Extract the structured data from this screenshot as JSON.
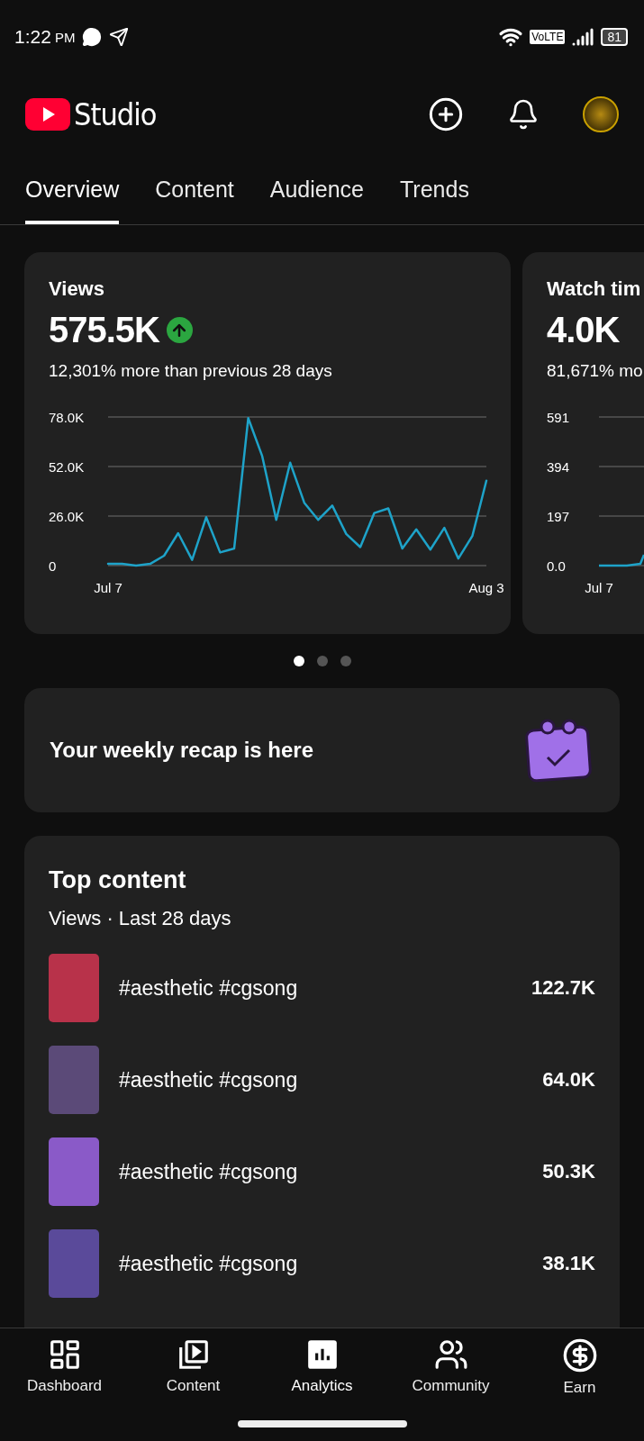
{
  "status_bar": {
    "time": "1:22",
    "period": "PM",
    "network": "VoLTE",
    "battery": "81"
  },
  "header": {
    "app_name": "Studio"
  },
  "tabs": [
    {
      "label": "Overview",
      "selected": true
    },
    {
      "label": "Content",
      "selected": false
    },
    {
      "label": "Audience",
      "selected": false
    },
    {
      "label": "Trends",
      "selected": false
    }
  ],
  "metric_cards": [
    {
      "title": "Views",
      "value": "575.5K",
      "comparison": "12,301% more than previous 28 days",
      "chart_data": {
        "type": "line",
        "categories": [
          "Jul 7",
          null,
          null,
          null,
          null,
          null,
          null,
          null,
          null,
          null,
          null,
          null,
          null,
          null,
          null,
          null,
          null,
          null,
          null,
          null,
          null,
          null,
          null,
          null,
          null,
          null,
          null,
          "Aug 3"
        ],
        "ylim": [
          0,
          78000
        ],
        "yticks": [
          {
            "value": 0,
            "label": "0"
          },
          {
            "value": 26000,
            "label": "26.0K"
          },
          {
            "value": 52000,
            "label": "52.0K"
          },
          {
            "value": 78000,
            "label": "78.0K"
          }
        ],
        "series": [
          {
            "color": "#1ea3c9",
            "values": [
              900,
              900,
              0,
              900,
              5200,
              17000,
              3000,
              25400,
              6900,
              9000,
              77400,
              57500,
              24000,
              54000,
              33000,
              24000,
              31500,
              16600,
              9700,
              27600,
              30000,
              9000,
              19000,
              8400,
              19800,
              3700,
              15500,
              44600
            ]
          }
        ]
      }
    },
    {
      "title": "Watch tim",
      "value": "4.0K",
      "comparison": "81,671% mo",
      "chart_picture": {
        "y_axis_labels": [
          "591",
          "394",
          "197",
          "0.0"
        ],
        "x_axis_label": "Jul 7"
      }
    }
  ],
  "carousel_dots": [
    {
      "selected": true
    },
    {
      "selected": false
    },
    {
      "selected": false
    }
  ],
  "recap": {
    "text": "Your weekly recap is here"
  },
  "top_content": {
    "title": "Top content",
    "subtitle": "Views · Last 28 days",
    "items": [
      {
        "title": "#aesthetic #cgsong",
        "views": "122.7K"
      },
      {
        "title": "#aesthetic #cgsong",
        "views": "64.0K"
      },
      {
        "title": "#aesthetic #cgsong",
        "views": "50.3K"
      },
      {
        "title": "#aesthetic #cgsong",
        "views": "38.1K"
      }
    ]
  },
  "bottom_nav": [
    {
      "kind": "dashboard",
      "label": "Dashboard",
      "selected": false
    },
    {
      "kind": "content",
      "label": "Content",
      "selected": false
    },
    {
      "kind": "analytics",
      "label": "Analytics",
      "selected": true
    },
    {
      "kind": "community",
      "label": "Community",
      "selected": false
    },
    {
      "kind": "earn",
      "label": "Earn",
      "selected": false
    }
  ]
}
